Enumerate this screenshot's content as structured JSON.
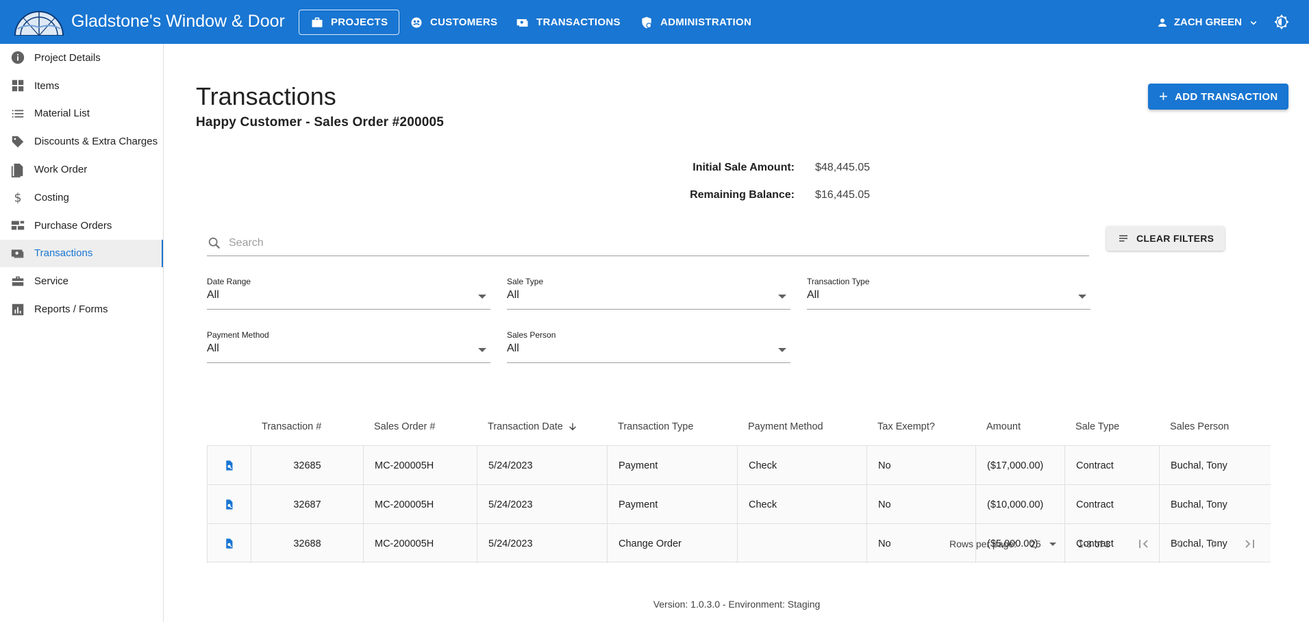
{
  "app": {
    "brand": "Gladstone's Window & Door",
    "user_name": "ZACH GREEN"
  },
  "nav": {
    "projects": "PROJECTS",
    "customers": "CUSTOMERS",
    "transactions": "TRANSACTIONS",
    "administration": "ADMINISTRATION"
  },
  "sidebar": {
    "items": [
      {
        "label": "Project Details",
        "icon": "info-icon"
      },
      {
        "label": "Items",
        "icon": "grid-icon"
      },
      {
        "label": "Material List",
        "icon": "list-icon"
      },
      {
        "label": "Discounts & Extra Charges",
        "icon": "tag-icon"
      },
      {
        "label": "Work Order",
        "icon": "document-icon"
      },
      {
        "label": "Costing",
        "icon": "dollar-icon"
      },
      {
        "label": "Purchase Orders",
        "icon": "purchase-icon"
      },
      {
        "label": "Transactions",
        "icon": "money-icon",
        "active": true
      },
      {
        "label": "Service",
        "icon": "toolbox-icon"
      },
      {
        "label": "Reports / Forms",
        "icon": "chart-icon"
      }
    ]
  },
  "page": {
    "title": "Transactions",
    "subtitle": "Happy Customer - Sales Order #200005",
    "add_button": "ADD TRANSACTION"
  },
  "summary": {
    "initial_label": "Initial Sale Amount:",
    "initial_value": "$48,445.05",
    "remaining_label": "Remaining Balance:",
    "remaining_value": "$16,445.05"
  },
  "search": {
    "placeholder": "Search",
    "value": ""
  },
  "clear_filters": "CLEAR FILTERS",
  "filters": {
    "date_range": {
      "label": "Date Range",
      "value": "All"
    },
    "sale_type": {
      "label": "Sale Type",
      "value": "All"
    },
    "transaction_type": {
      "label": "Transaction Type",
      "value": "All"
    },
    "payment_method": {
      "label": "Payment Method",
      "value": "All"
    },
    "sales_person": {
      "label": "Sales Person",
      "value": "All"
    }
  },
  "table": {
    "headers": {
      "transaction_no": "Transaction #",
      "sales_order_no": "Sales Order #",
      "transaction_date": "Transaction Date",
      "transaction_type": "Transaction Type",
      "payment_method": "Payment Method",
      "tax_exempt": "Tax Exempt?",
      "amount": "Amount",
      "sale_type": "Sale Type",
      "sales_person": "Sales Person"
    },
    "rows": [
      {
        "transaction_no": "32685",
        "sales_order_no": "MC-200005H",
        "transaction_date": "5/24/2023",
        "transaction_type": "Payment",
        "payment_method": "Check",
        "tax_exempt": "No",
        "amount": "($17,000.00)",
        "sale_type": "Contract",
        "sales_person": "Buchal, Tony"
      },
      {
        "transaction_no": "32687",
        "sales_order_no": "MC-200005H",
        "transaction_date": "5/24/2023",
        "transaction_type": "Payment",
        "payment_method": "Check",
        "tax_exempt": "No",
        "amount": "($10,000.00)",
        "sale_type": "Contract",
        "sales_person": "Buchal, Tony"
      },
      {
        "transaction_no": "32688",
        "sales_order_no": "MC-200005H",
        "transaction_date": "5/24/2023",
        "transaction_type": "Change Order",
        "payment_method": "",
        "tax_exempt": "No",
        "amount": "($5,000.00)",
        "sale_type": "Contract",
        "sales_person": "Buchal, Tony"
      }
    ]
  },
  "pagination": {
    "rows_per_page_label": "Rows per page:",
    "rows_per_page": "25",
    "range": "1-3 of 3"
  },
  "footer": "Version: 1.0.3.0 - Environment: Staging",
  "colors": {
    "primary": "#1976d2"
  }
}
